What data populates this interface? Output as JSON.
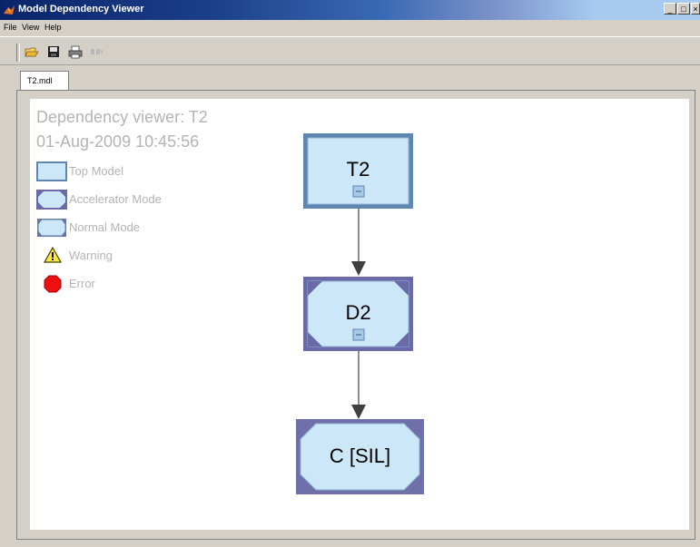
{
  "window": {
    "title": "Model Dependency Viewer",
    "controls": [
      "_",
      "□",
      "×"
    ]
  },
  "menu": [
    "File",
    "View",
    "Help"
  ],
  "toolbar": {
    "buttons": [
      "open-icon",
      "save-icon",
      "print-icon",
      "disabled-icon"
    ]
  },
  "tab": {
    "label": "T2.mdl"
  },
  "viewer": {
    "title": "Dependency viewer: T2",
    "timestamp": "01-Aug-2009 10:45:56"
  },
  "legend": [
    {
      "label": "Top Model",
      "icon": "top-model-icon"
    },
    {
      "label": "Accelerator Mode",
      "icon": "accelerator-mode-icon"
    },
    {
      "label": "Normal Mode",
      "icon": "normal-mode-icon"
    },
    {
      "label": "Warning",
      "icon": "warning-icon"
    },
    {
      "label": "Error",
      "icon": "error-icon"
    }
  ],
  "nodes": [
    {
      "label": "T2",
      "mode": "Top Model"
    },
    {
      "label": "D2",
      "mode": "Accelerator Mode"
    },
    {
      "label": "C [SIL]",
      "mode": "Normal Mode"
    }
  ],
  "colors": {
    "node_fill": "#cce8f8",
    "node_border": "#5f86b0",
    "accelerator_border": "#6a6aa8",
    "corner_fill": "#7070a8",
    "legend_text": "#b4b4b4"
  }
}
